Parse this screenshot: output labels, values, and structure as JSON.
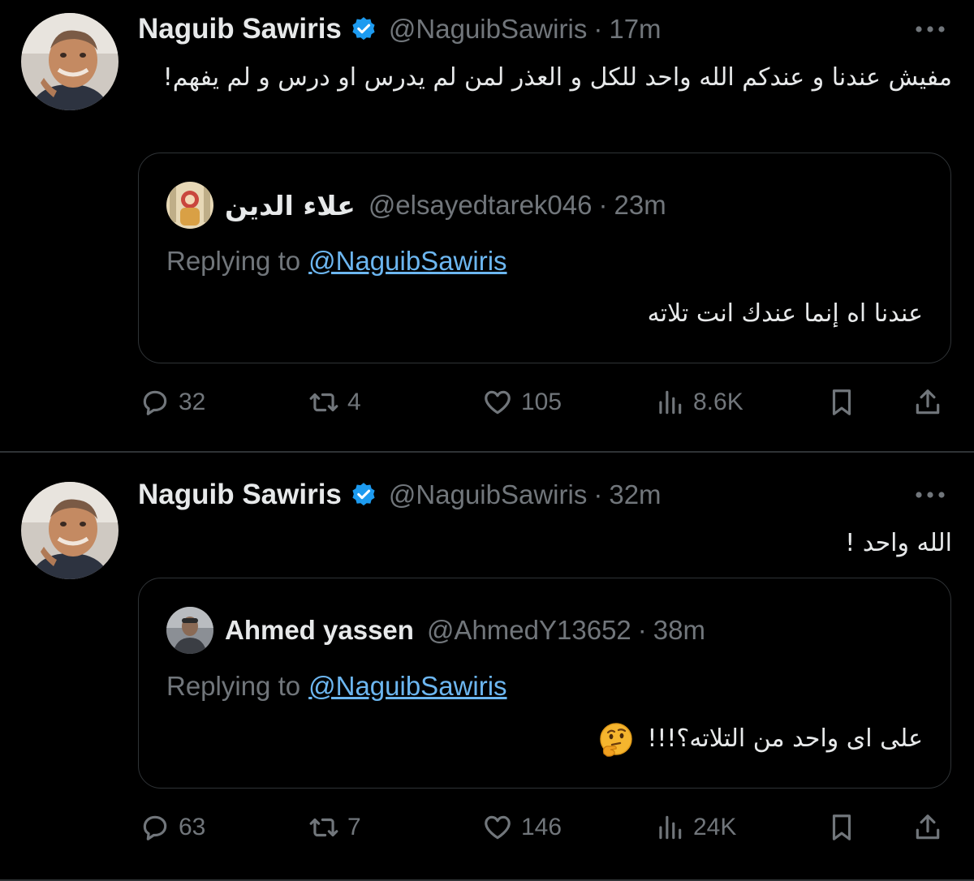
{
  "tweets": [
    {
      "author": {
        "name": "Naguib Sawiris",
        "handle": "@NaguibSawiris",
        "separator": "·",
        "time": "17m"
      },
      "text": "مفيش عندنا و عندكم الله واحد للكل و العذر لمن لم يدرس او درس و لم يفهم!",
      "quoted": {
        "author": {
          "name": "علاء الدين",
          "handle": "@elsayedtarek046",
          "separator": "·",
          "time": "23m"
        },
        "replying_label": "Replying to",
        "replying_handle": "@NaguibSawiris",
        "text": "عندنا اه إنما عندك انت تلاته"
      },
      "stats": {
        "replies": "32",
        "retweets": "4",
        "likes": "105",
        "views": "8.6K"
      }
    },
    {
      "author": {
        "name": "Naguib Sawiris",
        "handle": "@NaguibSawiris",
        "separator": "·",
        "time": "32m"
      },
      "text": "الله واحد !",
      "quoted": {
        "author": {
          "name": "Ahmed yassen",
          "handle": "@AhmedY13652",
          "separator": "·",
          "time": "38m"
        },
        "replying_label": "Replying to",
        "replying_handle": "@NaguibSawiris",
        "text": "على اى واحد من التلاته؟!!!",
        "emoji": "thinking-face-emoji"
      },
      "stats": {
        "replies": "63",
        "retweets": "7",
        "likes": "146",
        "views": "24K"
      }
    }
  ],
  "colors": {
    "background": "#000000",
    "primary_text": "#e7e9ea",
    "secondary_text": "#71767b",
    "link": "#6cb6f0",
    "verified": "#1d9bf0",
    "border": "#2f3336"
  },
  "icons": [
    "verified-badge-icon",
    "more-options-icon",
    "reply-icon",
    "retweet-icon",
    "like-icon",
    "views-icon",
    "bookmark-icon",
    "share-icon",
    "thinking-face-emoji"
  ]
}
